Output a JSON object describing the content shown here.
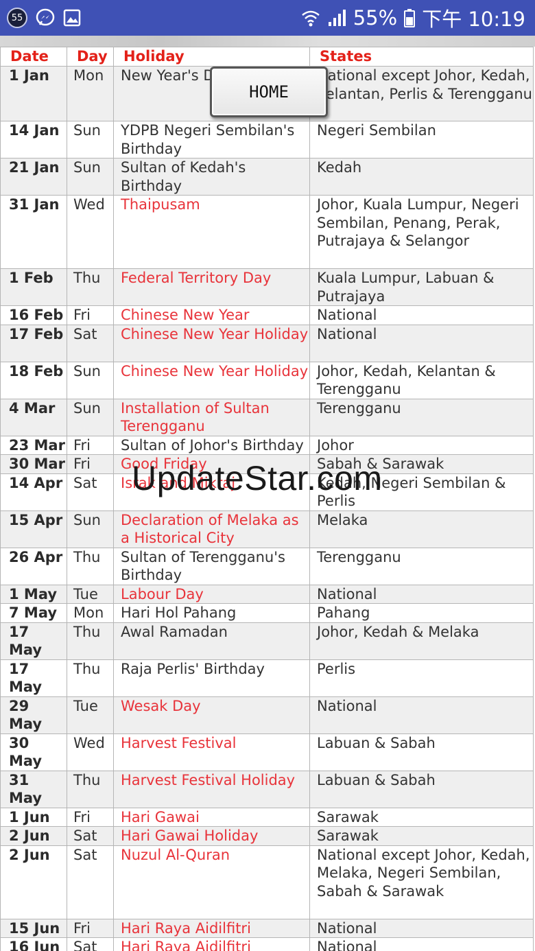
{
  "statusbar": {
    "notification_count": "55",
    "battery": "55%",
    "time": "下午 10:19"
  },
  "table": {
    "headers": [
      "Date",
      "Day",
      "Holiday",
      "States"
    ],
    "rows": [
      {
        "date": "1 Jan",
        "day": "Mon",
        "holiday": "New Year's Day",
        "states": "National except Johor, Kedah, Kelantan, Perlis & Terengganu",
        "red": false,
        "h": 80
      },
      {
        "date": "14 Jan",
        "day": "Sun",
        "holiday": "YDPB Negeri Sembilan's Birthday",
        "states": "Negeri Sembilan",
        "red": false,
        "h": 54
      },
      {
        "date": "21 Jan",
        "day": "Sun",
        "holiday": "Sultan of Kedah's Birthday",
        "states": "Kedah",
        "red": false,
        "h": 54
      },
      {
        "date": "31 Jan",
        "day": "Wed",
        "holiday": "Thaipusam",
        "states": "Johor, Kuala Lumpur, Negeri Sembilan, Penang, Perak, Putrajaya & Selangor",
        "red": true,
        "h": 107
      },
      {
        "date": "1 Feb",
        "day": "Thu",
        "holiday": "Federal Territory Day",
        "states": "Kuala Lumpur, Labuan & Putrajaya",
        "red": true,
        "h": 54
      },
      {
        "date": "16 Feb",
        "day": "Fri",
        "holiday": "Chinese New Year",
        "states": "National",
        "red": true,
        "h": 27
      },
      {
        "date": "17 Feb",
        "day": "Sat",
        "holiday": "Chinese New Year Holiday",
        "states": "National",
        "red": true,
        "h": 54
      },
      {
        "date": "18 Feb",
        "day": "Sun",
        "holiday": "Chinese New Year Holiday",
        "states": "Johor, Kedah, Kelantan & Terengganu",
        "red": true,
        "h": 54
      },
      {
        "date": "4 Mar",
        "day": "Sun",
        "holiday": "Installation of Sultan Terengganu",
        "states": "Terengganu",
        "red": true,
        "h": 54
      },
      {
        "date": "23 Mar",
        "day": "Fri",
        "holiday": "Sultan of Johor's Birthday",
        "states": "Johor",
        "red": false,
        "h": 27
      },
      {
        "date": "30 Mar",
        "day": "Fri",
        "holiday": "Good Friday",
        "states": "Sabah & Sarawak",
        "red": true,
        "h": 27
      },
      {
        "date": "14 Apr",
        "day": "Sat",
        "holiday": "Israk and Mikraj",
        "states": "Kedah, Negeri Sembilan & Perlis",
        "red": true,
        "h": 54
      },
      {
        "date": "15 Apr",
        "day": "Sun",
        "holiday": "Declaration of Melaka as a Historical City",
        "states": "Melaka",
        "red": true,
        "h": 54
      },
      {
        "date": "26 Apr",
        "day": "Thu",
        "holiday": "Sultan of Terengganu's Birthday",
        "states": "Terengganu",
        "red": false,
        "h": 54
      },
      {
        "date": "1 May",
        "day": "Tue",
        "holiday": "Labour Day",
        "states": "National",
        "red": true,
        "h": 27
      },
      {
        "date": "7 May",
        "day": "Mon",
        "holiday": "Hari Hol Pahang",
        "states": "Pahang",
        "red": false,
        "h": 27
      },
      {
        "date": "17 May",
        "day": "Thu",
        "holiday": "Awal Ramadan",
        "states": "Johor, Kedah & Melaka",
        "red": false,
        "h": 54
      },
      {
        "date": "17 May",
        "day": "Thu",
        "holiday": "Raja Perlis' Birthday",
        "states": "Perlis",
        "red": false,
        "h": 54
      },
      {
        "date": "29 May",
        "day": "Tue",
        "holiday": "Wesak Day",
        "states": "National",
        "red": true,
        "h": 54
      },
      {
        "date": "30 May",
        "day": "Wed",
        "holiday": "Harvest Festival",
        "states": "Labuan & Sabah",
        "red": true,
        "h": 54
      },
      {
        "date": "31 May",
        "day": "Thu",
        "holiday": "Harvest Festival Holiday",
        "states": "Labuan & Sabah",
        "red": true,
        "h": 54
      },
      {
        "date": "1 Jun",
        "day": "Fri",
        "holiday": "Hari Gawai",
        "states": "Sarawak",
        "red": true,
        "h": 27
      },
      {
        "date": "2 Jun",
        "day": "Sat",
        "holiday": "Hari Gawai Holiday",
        "states": "Sarawak",
        "red": true,
        "h": 27
      },
      {
        "date": "2 Jun",
        "day": "Sat",
        "holiday": "Nuzul Al-Quran",
        "states": "National except Johor, Kedah, Melaka, Negeri Sembilan, Sabah & Sarawak",
        "red": true,
        "h": 107
      },
      {
        "date": "15 Jun",
        "day": "Fri",
        "holiday": "Hari Raya Aidilfitri",
        "states": "National",
        "red": true,
        "h": 27
      },
      {
        "date": "16 Jun",
        "day": "Sat",
        "holiday": "Hari Raya Aidilfitri",
        "states": "National",
        "red": true,
        "h": 27
      }
    ]
  },
  "home_button": {
    "label": "HOME"
  },
  "watermark": "UpdateStar.com"
}
